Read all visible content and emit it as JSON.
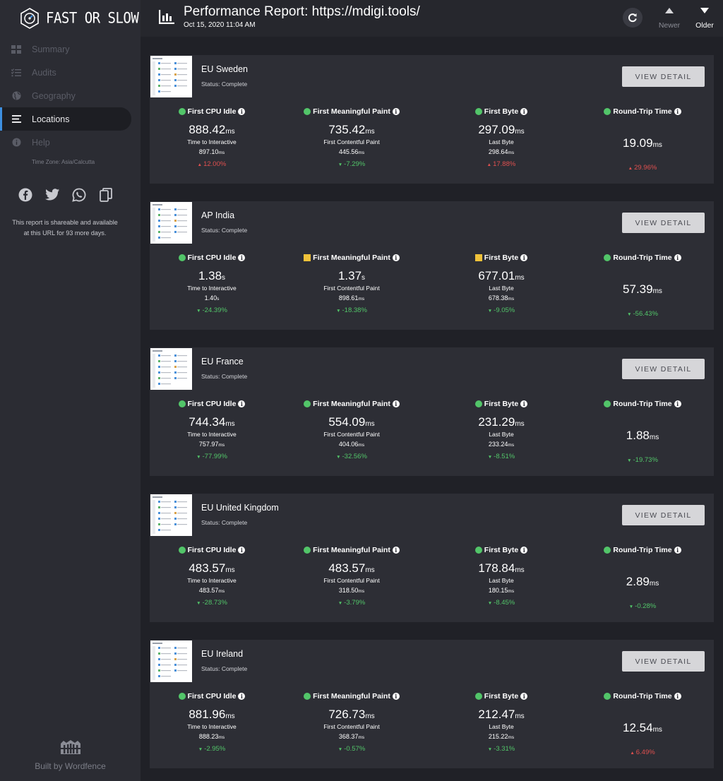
{
  "brand": {
    "name": "FAST OR SLOW",
    "built_by": "Built by Wordfence"
  },
  "header": {
    "title": "Performance Report: https://mdigi.tools/",
    "date": "Oct 15, 2020 11:04 AM",
    "newer_label": "Newer",
    "older_label": "Older"
  },
  "sidebar": {
    "items": [
      {
        "label": "Summary",
        "icon": "grid-icon"
      },
      {
        "label": "Audits",
        "icon": "checklist-icon"
      },
      {
        "label": "Geography",
        "icon": "globe-icon"
      },
      {
        "label": "Locations",
        "icon": "list-icon"
      },
      {
        "label": "Help",
        "icon": "info-icon"
      }
    ],
    "timezone": "Time Zone: Asia/Calcutta",
    "share_line1": "This report is shareable and available",
    "share_line2": "at this URL for 93 more days."
  },
  "metric_titles": {
    "cpu": "First CPU Idle",
    "fmp": "First Meaningful Paint",
    "fb": "First Byte",
    "rtt": "Round-Trip Time"
  },
  "metric_subs": {
    "cpu": "Time to Interactive",
    "fmp": "First Contentful Paint",
    "fb": "Last Byte"
  },
  "view_label": "VIEW DETAIL",
  "locations": [
    {
      "name": "EU Sweden",
      "status": "Status: Complete",
      "cpu": {
        "v": "888.42",
        "u": "ms",
        "v2": "897.10",
        "u2": "ms",
        "d": "12.00%",
        "dir": "up",
        "mark": "good"
      },
      "fmp": {
        "v": "735.42",
        "u": "ms",
        "v2": "445.56",
        "u2": "ms",
        "d": "-7.29%",
        "dir": "down",
        "mark": "good"
      },
      "fb": {
        "v": "297.09",
        "u": "ms",
        "v2": "298.64",
        "u2": "ms",
        "d": "17.88%",
        "dir": "up",
        "mark": "good"
      },
      "rtt": {
        "v": "19.09",
        "u": "ms",
        "d": "29.96%",
        "dir": "up",
        "mark": "good"
      }
    },
    {
      "name": "AP India",
      "status": "Status: Complete",
      "cpu": {
        "v": "1.38",
        "u": "s",
        "v2": "1.40",
        "u2": "s",
        "d": "-24.39%",
        "dir": "down",
        "mark": "good"
      },
      "fmp": {
        "v": "1.37",
        "u": "s",
        "v2": "898.61",
        "u2": "ms",
        "d": "-18.38%",
        "dir": "down",
        "mark": "warn"
      },
      "fb": {
        "v": "677.01",
        "u": "ms",
        "v2": "678.38",
        "u2": "ms",
        "d": "-9.05%",
        "dir": "down",
        "mark": "warn"
      },
      "rtt": {
        "v": "57.39",
        "u": "ms",
        "d": "-56.43%",
        "dir": "down",
        "mark": "good"
      }
    },
    {
      "name": "EU France",
      "status": "Status: Complete",
      "cpu": {
        "v": "744.34",
        "u": "ms",
        "v2": "757.97",
        "u2": "ms",
        "d": "-77.99%",
        "dir": "down",
        "mark": "good"
      },
      "fmp": {
        "v": "554.09",
        "u": "ms",
        "v2": "404.06",
        "u2": "ms",
        "d": "-32.56%",
        "dir": "down",
        "mark": "good"
      },
      "fb": {
        "v": "231.29",
        "u": "ms",
        "v2": "233.24",
        "u2": "ms",
        "d": "-8.51%",
        "dir": "down",
        "mark": "good"
      },
      "rtt": {
        "v": "1.88",
        "u": "ms",
        "d": "-19.73%",
        "dir": "down",
        "mark": "good"
      }
    },
    {
      "name": "EU United Kingdom",
      "status": "Status: Complete",
      "cpu": {
        "v": "483.57",
        "u": "ms",
        "v2": "483.57",
        "u2": "ms",
        "d": "-28.73%",
        "dir": "down",
        "mark": "good"
      },
      "fmp": {
        "v": "483.57",
        "u": "ms",
        "v2": "318.50",
        "u2": "ms",
        "d": "-3.79%",
        "dir": "down",
        "mark": "good"
      },
      "fb": {
        "v": "178.84",
        "u": "ms",
        "v2": "180.15",
        "u2": "ms",
        "d": "-8.45%",
        "dir": "down",
        "mark": "good"
      },
      "rtt": {
        "v": "2.89",
        "u": "ms",
        "d": "-0.28%",
        "dir": "down",
        "mark": "good"
      }
    },
    {
      "name": "EU Ireland",
      "status": "Status: Complete",
      "cpu": {
        "v": "881.96",
        "u": "ms",
        "v2": "888.23",
        "u2": "ms",
        "d": "-2.95%",
        "dir": "down",
        "mark": "good"
      },
      "fmp": {
        "v": "726.73",
        "u": "ms",
        "v2": "368.37",
        "u2": "ms",
        "d": "-0.57%",
        "dir": "down",
        "mark": "good"
      },
      "fb": {
        "v": "212.47",
        "u": "ms",
        "v2": "215.22",
        "u2": "ms",
        "d": "-3.31%",
        "dir": "down",
        "mark": "good"
      },
      "rtt": {
        "v": "12.54",
        "u": "ms",
        "d": "6.49%",
        "dir": "up",
        "mark": "good"
      }
    }
  ]
}
